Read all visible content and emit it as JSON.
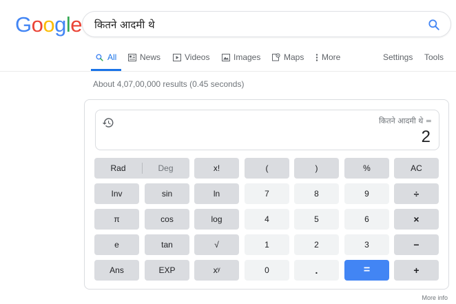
{
  "logo": {
    "letters": [
      "G",
      "o",
      "o",
      "g",
      "l",
      "e"
    ],
    "colors": [
      "#4285f4",
      "#ea4335",
      "#fbbc05",
      "#4285f4",
      "#34a853",
      "#ea4335"
    ]
  },
  "search": {
    "query": "कितने आदमी थे",
    "accent": "#4285f4"
  },
  "tabs": {
    "all": "All",
    "news": "News",
    "videos": "Videos",
    "images": "Images",
    "maps": "Maps",
    "more": "More",
    "settings": "Settings",
    "tools": "Tools"
  },
  "results_stats": "About 4,07,00,000 results (0.45 seconds)",
  "calculator": {
    "expression": "कितने आदमी थे =",
    "result": "2",
    "keys": {
      "rad": "Rad",
      "deg": "Deg",
      "fact": "x!",
      "lparen": "(",
      "rparen": ")",
      "percent": "%",
      "ac": "AC",
      "inv": "Inv",
      "sin": "sin",
      "ln": "ln",
      "seven": "7",
      "eight": "8",
      "nine": "9",
      "divide": "÷",
      "pi": "π",
      "cos": "cos",
      "log": "log",
      "four": "4",
      "five": "5",
      "six": "6",
      "multiply": "×",
      "e": "e",
      "tan": "tan",
      "sqrt": "√",
      "one": "1",
      "two": "2",
      "three": "3",
      "minus": "−",
      "ans": "Ans",
      "exp": "EXP",
      "power": "xʸ",
      "zero": "0",
      "dot": ".",
      "equals": "=",
      "plus": "+"
    }
  },
  "more_info": "More info"
}
